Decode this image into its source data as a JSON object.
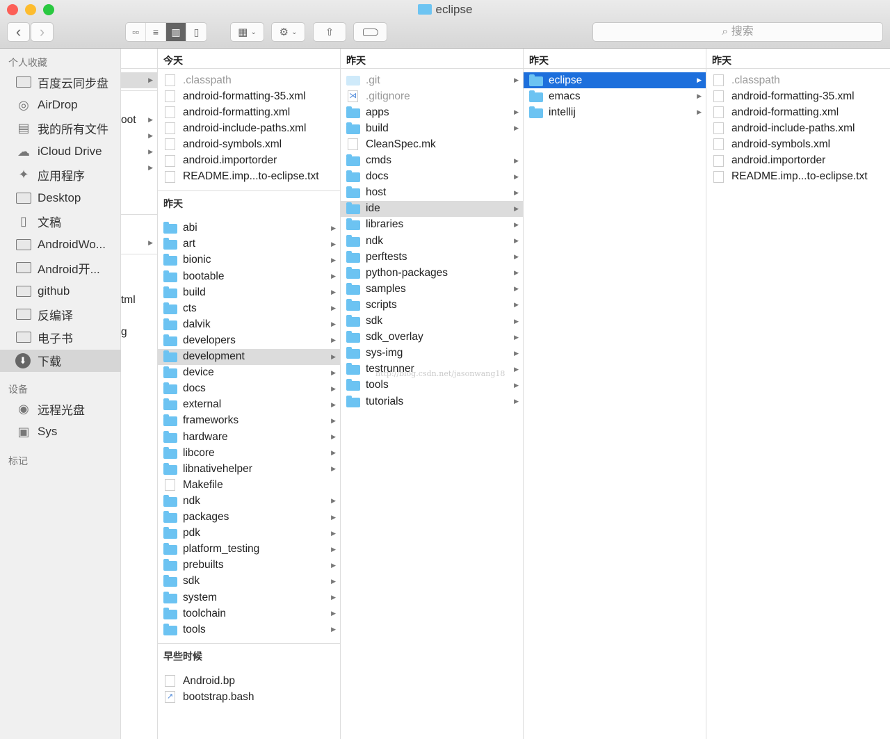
{
  "window": {
    "title": "eclipse",
    "search_placeholder": "搜索",
    "watermark": "http://blog.csdn.net/jasonwang18"
  },
  "toolbar": {
    "back": "‹",
    "forward": "›"
  },
  "sidebar": {
    "favorites_label": "个人收藏",
    "devices_label": "设备",
    "tags_label": "标记",
    "favorites": [
      {
        "label": "百度云同步盘",
        "icon": "folder-icon"
      },
      {
        "label": "AirDrop",
        "icon": "airdrop-icon"
      },
      {
        "label": "我的所有文件",
        "icon": "all-files-icon"
      },
      {
        "label": "iCloud Drive",
        "icon": "cloud-icon"
      },
      {
        "label": "应用程序",
        "icon": "applications-icon"
      },
      {
        "label": "Desktop",
        "icon": "desktop-icon"
      },
      {
        "label": "文稿",
        "icon": "documents-icon"
      },
      {
        "label": "AndroidWo...",
        "icon": "folder-icon"
      },
      {
        "label": "Android开...",
        "icon": "folder-icon"
      },
      {
        "label": "github",
        "icon": "folder-icon"
      },
      {
        "label": "反编译",
        "icon": "folder-icon"
      },
      {
        "label": "电子书",
        "icon": "folder-icon"
      },
      {
        "label": "下载",
        "icon": "download-icon",
        "selected": true
      }
    ],
    "devices": [
      {
        "label": "远程光盘",
        "icon": "disc-icon"
      },
      {
        "label": "Sys",
        "icon": "drive-icon"
      }
    ]
  },
  "col0": {
    "fragments": [
      "oot",
      "tml",
      "g"
    ]
  },
  "col1": {
    "sections": [
      {
        "label": "今天",
        "items": [
          {
            "name": ".classpath",
            "type": "file",
            "dim": true
          },
          {
            "name": "android-formatting-35.xml",
            "type": "file"
          },
          {
            "name": "android-formatting.xml",
            "type": "file"
          },
          {
            "name": "android-include-paths.xml",
            "type": "file"
          },
          {
            "name": "android-symbols.xml",
            "type": "file"
          },
          {
            "name": "android.importorder",
            "type": "file"
          },
          {
            "name": "README.imp...to-eclipse.txt",
            "type": "file"
          }
        ]
      },
      {
        "label": "昨天",
        "items": [
          {
            "name": "abi",
            "type": "folder"
          },
          {
            "name": "art",
            "type": "folder"
          },
          {
            "name": "bionic",
            "type": "folder"
          },
          {
            "name": "bootable",
            "type": "folder"
          },
          {
            "name": "build",
            "type": "folder"
          },
          {
            "name": "cts",
            "type": "folder"
          },
          {
            "name": "dalvik",
            "type": "folder"
          },
          {
            "name": "developers",
            "type": "folder"
          },
          {
            "name": "development",
            "type": "folder",
            "selected": "grey"
          },
          {
            "name": "device",
            "type": "folder"
          },
          {
            "name": "docs",
            "type": "folder"
          },
          {
            "name": "external",
            "type": "folder"
          },
          {
            "name": "frameworks",
            "type": "folder"
          },
          {
            "name": "hardware",
            "type": "folder"
          },
          {
            "name": "libcore",
            "type": "folder"
          },
          {
            "name": "libnativehelper",
            "type": "folder"
          },
          {
            "name": "Makefile",
            "type": "file"
          },
          {
            "name": "ndk",
            "type": "folder"
          },
          {
            "name": "packages",
            "type": "folder"
          },
          {
            "name": "pdk",
            "type": "folder"
          },
          {
            "name": "platform_testing",
            "type": "folder"
          },
          {
            "name": "prebuilts",
            "type": "folder"
          },
          {
            "name": "sdk",
            "type": "folder"
          },
          {
            "name": "system",
            "type": "folder"
          },
          {
            "name": "toolchain",
            "type": "folder"
          },
          {
            "name": "tools",
            "type": "folder"
          }
        ]
      },
      {
        "label": "早些时候",
        "items": [
          {
            "name": "Android.bp",
            "type": "file"
          },
          {
            "name": "bootstrap.bash",
            "type": "script"
          }
        ]
      }
    ]
  },
  "col2": {
    "sections": [
      {
        "label": "昨天",
        "items": [
          {
            "name": ".git",
            "type": "folderlight",
            "dim": true
          },
          {
            "name": ".gitignore",
            "type": "gitignore",
            "dim": true
          },
          {
            "name": "apps",
            "type": "folder"
          },
          {
            "name": "build",
            "type": "folder"
          },
          {
            "name": "CleanSpec.mk",
            "type": "file"
          },
          {
            "name": "cmds",
            "type": "folder"
          },
          {
            "name": "docs",
            "type": "folder"
          },
          {
            "name": "host",
            "type": "folder"
          },
          {
            "name": "ide",
            "type": "folder",
            "selected": "grey"
          },
          {
            "name": "libraries",
            "type": "folder"
          },
          {
            "name": "ndk",
            "type": "folder"
          },
          {
            "name": "perftests",
            "type": "folder"
          },
          {
            "name": "python-packages",
            "type": "folder"
          },
          {
            "name": "samples",
            "type": "folder"
          },
          {
            "name": "scripts",
            "type": "folder"
          },
          {
            "name": "sdk",
            "type": "folder"
          },
          {
            "name": "sdk_overlay",
            "type": "folder"
          },
          {
            "name": "sys-img",
            "type": "folder"
          },
          {
            "name": "testrunner",
            "type": "folder"
          },
          {
            "name": "tools",
            "type": "folder"
          },
          {
            "name": "tutorials",
            "type": "folder"
          }
        ]
      }
    ]
  },
  "col3": {
    "sections": [
      {
        "label": "昨天",
        "items": [
          {
            "name": "eclipse",
            "type": "folder",
            "selected": "blue"
          },
          {
            "name": "emacs",
            "type": "folder"
          },
          {
            "name": "intellij",
            "type": "folder"
          }
        ]
      }
    ]
  },
  "col4": {
    "sections": [
      {
        "label": "昨天",
        "items": [
          {
            "name": ".classpath",
            "type": "file",
            "dim": true
          },
          {
            "name": "android-formatting-35.xml",
            "type": "file"
          },
          {
            "name": "android-formatting.xml",
            "type": "file"
          },
          {
            "name": "android-include-paths.xml",
            "type": "file"
          },
          {
            "name": "android-symbols.xml",
            "type": "file"
          },
          {
            "name": "android.importorder",
            "type": "file"
          },
          {
            "name": "README.imp...to-eclipse.txt",
            "type": "file"
          }
        ]
      }
    ]
  }
}
